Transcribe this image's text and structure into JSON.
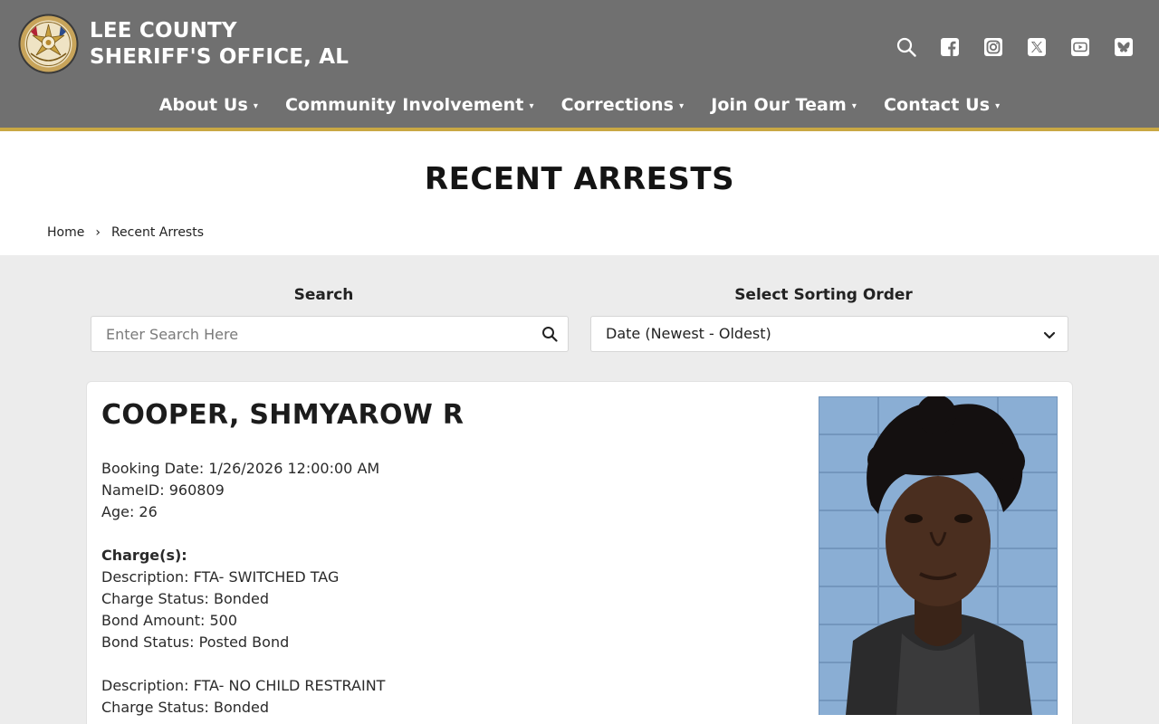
{
  "header": {
    "title_line1": "LEE COUNTY",
    "title_line2": "SHERIFF'S OFFICE, AL",
    "bg_color": "#707070",
    "accent_color": "#c9a844",
    "social_icons": [
      "search-icon",
      "facebook-icon",
      "instagram-icon",
      "x-twitter-icon",
      "youtube-icon",
      "bluesky-icon"
    ]
  },
  "nav": {
    "items": [
      {
        "label": "About Us"
      },
      {
        "label": "Community Involvement"
      },
      {
        "label": "Corrections"
      },
      {
        "label": "Join Our Team"
      },
      {
        "label": "Contact Us"
      }
    ],
    "caret": "▾"
  },
  "page": {
    "title": "RECENT ARRESTS"
  },
  "breadcrumb": {
    "home": "Home",
    "separator": "›",
    "current": "Recent Arrests"
  },
  "filters": {
    "search_label": "Search",
    "search_placeholder": "Enter Search Here",
    "search_value": "",
    "sort_label": "Select Sorting Order",
    "sort_value": "Date (Newest - Oldest)"
  },
  "arrest": {
    "name": "COOPER, SHMYAROW R",
    "booking_date": "Booking Date: 1/26/2026 12:00:00 AM",
    "name_id": "NameID: 960809",
    "age": "Age: 26",
    "charges_heading": "Charge(s):",
    "charges": [
      {
        "description": "Description: FTA- SWITCHED TAG",
        "charge_status": "Charge Status: Bonded",
        "bond_amount": "Bond Amount: 500",
        "bond_status": "Bond Status: Posted Bond"
      },
      {
        "description": "Description: FTA- NO CHILD RESTRAINT",
        "charge_status": "Charge Status: Bonded"
      }
    ]
  }
}
